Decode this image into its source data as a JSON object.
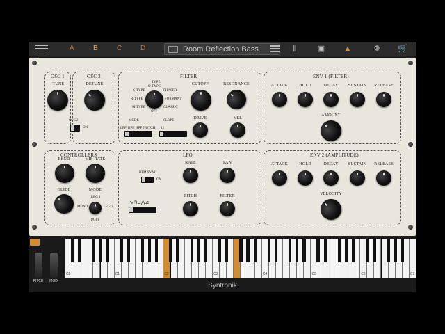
{
  "toolbar": {
    "slots": [
      "A",
      "B",
      "C",
      "D"
    ],
    "active_slot": "B",
    "preset_name": "Room Reflection Bass"
  },
  "osc1": {
    "title": "OSC 1",
    "tune": "TUNE"
  },
  "osc2": {
    "title": "OSC 2",
    "detune": "DETUNE",
    "switch_label": "OSC 2",
    "switch_state": "ON"
  },
  "filter": {
    "title": "FILTER",
    "type": "TYPE",
    "types": [
      "O-TYPE",
      "C-TYPE",
      "PHASER",
      "R-TYPE",
      "FORMANT",
      "M-TYPE",
      "CLASSIC",
      "OFF"
    ],
    "cutoff": "CUTOFF",
    "resonance": "RESONANCE",
    "mode": "MODE",
    "modes": [
      "LPF",
      "BPF",
      "HPF",
      "NOTCH"
    ],
    "slope": "SLOPE",
    "slope_value": "12",
    "drive": "DRIVE",
    "vel": "VEL"
  },
  "env1": {
    "title": "ENV 1 (FILTER)",
    "knobs": [
      "ATTACK",
      "HOLD",
      "DECAY",
      "SUSTAIN",
      "RELEASE"
    ],
    "amount": "AMOUNT"
  },
  "controllers": {
    "title": "CONTROLLERS",
    "bend": "BEND",
    "vibrate": "VIB RATE",
    "glide": "GLIDE",
    "mode": "MODE",
    "modes": [
      "LEG 1",
      "MONO",
      "LEG 2",
      "POLY"
    ]
  },
  "lfo": {
    "title": "LFO",
    "rate": "RATE",
    "pan": "PAN",
    "bpm_sync": "BPM SYNC",
    "bpm_state": "ON",
    "pitch": "PITCH",
    "filter": "FILTER"
  },
  "env2": {
    "title": "ENV 2 (AMPLITUDE)",
    "knobs": [
      "ATTACK",
      "HOLD",
      "DECAY",
      "SUSTAIN",
      "RELEASE"
    ],
    "velocity": "VELOCITY"
  },
  "keyboard": {
    "pitch": "PITCH",
    "mod": "MOD",
    "octaves": [
      "C0",
      "C1",
      "C2",
      "C3",
      "C4",
      "C5",
      "C6",
      "C7"
    ],
    "highlighted_keys": [
      14,
      24
    ]
  },
  "brand": "Syntronik",
  "colors": {
    "accent": "#d28d33",
    "panel": "#e9e6de"
  }
}
